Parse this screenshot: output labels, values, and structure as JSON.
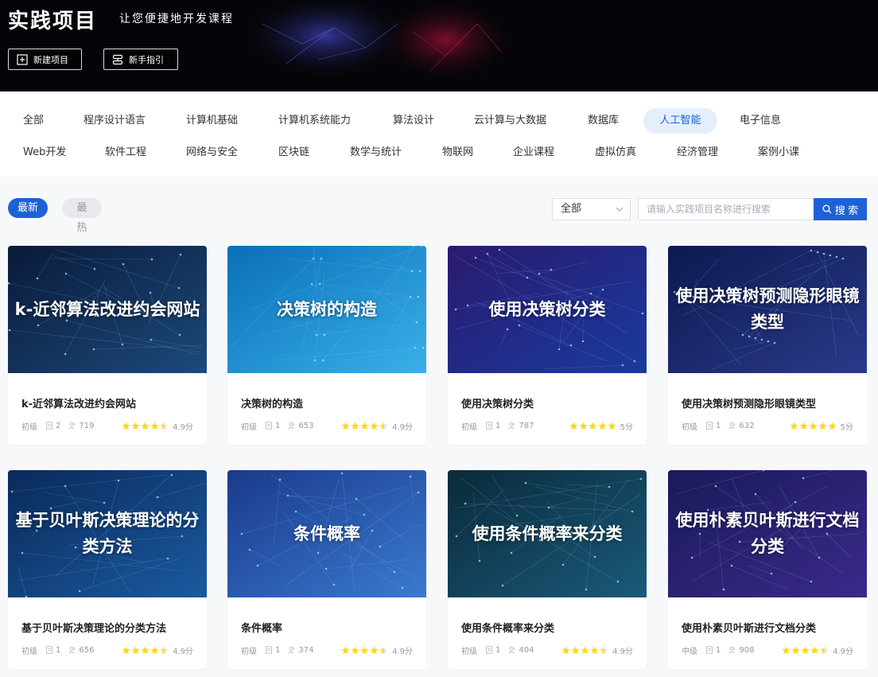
{
  "header": {
    "title": "实践项目",
    "subtitle": "让您便捷地开发课程",
    "new_project": "新建项目",
    "guide": "新手指引"
  },
  "categories": {
    "row1": [
      "全部",
      "程序设计语言",
      "计算机基础",
      "计算机系统能力",
      "算法设计",
      "云计算与大数据",
      "数据库",
      "人工智能",
      "电子信息"
    ],
    "row2": [
      "Web开发",
      "软件工程",
      "网络与安全",
      "区块链",
      "数学与统计",
      "物联网",
      "企业课程",
      "虚拟仿真",
      "经济管理",
      "案例小课"
    ],
    "active": "人工智能"
  },
  "filters": {
    "tab_new": "最新",
    "tab_hot": "最 热",
    "select_value": "全部",
    "search_placeholder": "请输入实践项目名称进行搜索",
    "search_label": "搜 索"
  },
  "colors": {
    "accent": "#1c61d6",
    "star": "#fadb14"
  },
  "cards": [
    {
      "cover_title": "k-近邻算法改进约会网站",
      "title": "k-近邻算法改进约会网站",
      "level": "初级",
      "docs": "2",
      "users": "719",
      "rating": 4.5,
      "score": "4.9分"
    },
    {
      "cover_title": "决策树的构造",
      "title": "决策树的构造",
      "level": "初级",
      "docs": "1",
      "users": "653",
      "rating": 4.5,
      "score": "4.9分"
    },
    {
      "cover_title": "使用决策树分类",
      "title": "使用决策树分类",
      "level": "初级",
      "docs": "1",
      "users": "787",
      "rating": 5,
      "score": "5分"
    },
    {
      "cover_title": "使用决策树预测隐形眼镜类型",
      "title": "使用决策树预测隐形眼镜类型",
      "level": "初级",
      "docs": "1",
      "users": "632",
      "rating": 5,
      "score": "5分"
    },
    {
      "cover_title": "基于贝叶斯决策理论的分类方法",
      "title": "基于贝叶斯决策理论的分类方法",
      "level": "初级",
      "docs": "1",
      "users": "656",
      "rating": 4.5,
      "score": "4.9分"
    },
    {
      "cover_title": "条件概率",
      "title": "条件概率",
      "level": "初级",
      "docs": "1",
      "users": "374",
      "rating": 4.5,
      "score": "4.9分"
    },
    {
      "cover_title": "使用条件概率来分类",
      "title": "使用条件概率来分类",
      "level": "初级",
      "docs": "1",
      "users": "404",
      "rating": 4.5,
      "score": "4.9分"
    },
    {
      "cover_title": "使用朴素贝叶斯进行文档分类",
      "title": "使用朴素贝叶斯进行文档分类",
      "level": "中级",
      "docs": "1",
      "users": "908",
      "rating": 4.5,
      "score": "4.9分"
    }
  ]
}
